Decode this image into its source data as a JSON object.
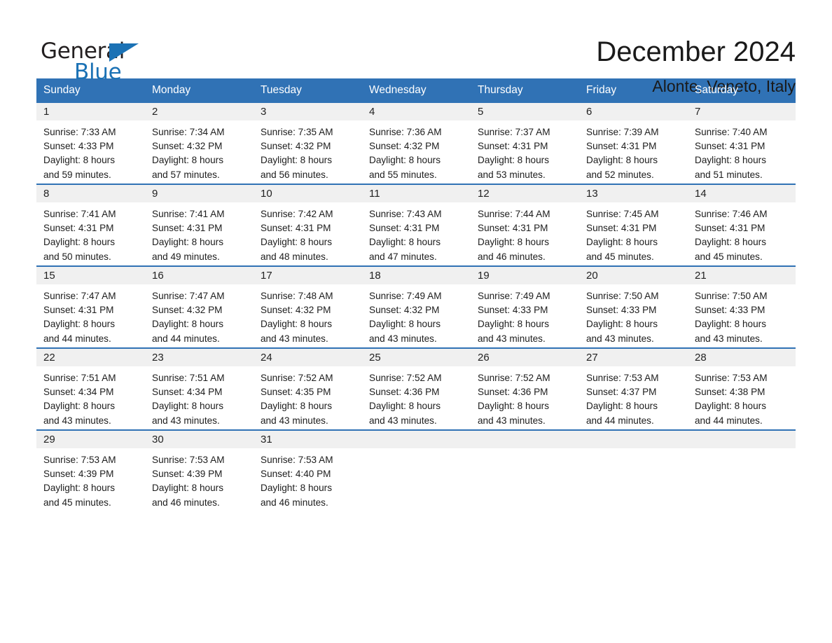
{
  "brand": {
    "logo_text_top": "General",
    "logo_text_bottom": "Blue",
    "logo_blue": "#1b72b5",
    "logo_black": "#231f20"
  },
  "header": {
    "title": "December 2024",
    "subtitle": "Alonte, Veneto, Italy"
  },
  "theme": {
    "header_blue": "#3072b5",
    "daynum_band": "#f0f0f0",
    "cell_bg": "#ffffff",
    "text": "#1a1a1a"
  },
  "calendar": {
    "weekday_headers": [
      "Sunday",
      "Monday",
      "Tuesday",
      "Wednesday",
      "Thursday",
      "Friday",
      "Saturday"
    ],
    "weeks": [
      [
        {
          "day": "1",
          "sunrise": "Sunrise: 7:33 AM",
          "sunset": "Sunset: 4:33 PM",
          "daylight1": "Daylight: 8 hours",
          "daylight2": "and 59 minutes."
        },
        {
          "day": "2",
          "sunrise": "Sunrise: 7:34 AM",
          "sunset": "Sunset: 4:32 PM",
          "daylight1": "Daylight: 8 hours",
          "daylight2": "and 57 minutes."
        },
        {
          "day": "3",
          "sunrise": "Sunrise: 7:35 AM",
          "sunset": "Sunset: 4:32 PM",
          "daylight1": "Daylight: 8 hours",
          "daylight2": "and 56 minutes."
        },
        {
          "day": "4",
          "sunrise": "Sunrise: 7:36 AM",
          "sunset": "Sunset: 4:32 PM",
          "daylight1": "Daylight: 8 hours",
          "daylight2": "and 55 minutes."
        },
        {
          "day": "5",
          "sunrise": "Sunrise: 7:37 AM",
          "sunset": "Sunset: 4:31 PM",
          "daylight1": "Daylight: 8 hours",
          "daylight2": "and 53 minutes."
        },
        {
          "day": "6",
          "sunrise": "Sunrise: 7:39 AM",
          "sunset": "Sunset: 4:31 PM",
          "daylight1": "Daylight: 8 hours",
          "daylight2": "and 52 minutes."
        },
        {
          "day": "7",
          "sunrise": "Sunrise: 7:40 AM",
          "sunset": "Sunset: 4:31 PM",
          "daylight1": "Daylight: 8 hours",
          "daylight2": "and 51 minutes."
        }
      ],
      [
        {
          "day": "8",
          "sunrise": "Sunrise: 7:41 AM",
          "sunset": "Sunset: 4:31 PM",
          "daylight1": "Daylight: 8 hours",
          "daylight2": "and 50 minutes."
        },
        {
          "day": "9",
          "sunrise": "Sunrise: 7:41 AM",
          "sunset": "Sunset: 4:31 PM",
          "daylight1": "Daylight: 8 hours",
          "daylight2": "and 49 minutes."
        },
        {
          "day": "10",
          "sunrise": "Sunrise: 7:42 AM",
          "sunset": "Sunset: 4:31 PM",
          "daylight1": "Daylight: 8 hours",
          "daylight2": "and 48 minutes."
        },
        {
          "day": "11",
          "sunrise": "Sunrise: 7:43 AM",
          "sunset": "Sunset: 4:31 PM",
          "daylight1": "Daylight: 8 hours",
          "daylight2": "and 47 minutes."
        },
        {
          "day": "12",
          "sunrise": "Sunrise: 7:44 AM",
          "sunset": "Sunset: 4:31 PM",
          "daylight1": "Daylight: 8 hours",
          "daylight2": "and 46 minutes."
        },
        {
          "day": "13",
          "sunrise": "Sunrise: 7:45 AM",
          "sunset": "Sunset: 4:31 PM",
          "daylight1": "Daylight: 8 hours",
          "daylight2": "and 45 minutes."
        },
        {
          "day": "14",
          "sunrise": "Sunrise: 7:46 AM",
          "sunset": "Sunset: 4:31 PM",
          "daylight1": "Daylight: 8 hours",
          "daylight2": "and 45 minutes."
        }
      ],
      [
        {
          "day": "15",
          "sunrise": "Sunrise: 7:47 AM",
          "sunset": "Sunset: 4:31 PM",
          "daylight1": "Daylight: 8 hours",
          "daylight2": "and 44 minutes."
        },
        {
          "day": "16",
          "sunrise": "Sunrise: 7:47 AM",
          "sunset": "Sunset: 4:32 PM",
          "daylight1": "Daylight: 8 hours",
          "daylight2": "and 44 minutes."
        },
        {
          "day": "17",
          "sunrise": "Sunrise: 7:48 AM",
          "sunset": "Sunset: 4:32 PM",
          "daylight1": "Daylight: 8 hours",
          "daylight2": "and 43 minutes."
        },
        {
          "day": "18",
          "sunrise": "Sunrise: 7:49 AM",
          "sunset": "Sunset: 4:32 PM",
          "daylight1": "Daylight: 8 hours",
          "daylight2": "and 43 minutes."
        },
        {
          "day": "19",
          "sunrise": "Sunrise: 7:49 AM",
          "sunset": "Sunset: 4:33 PM",
          "daylight1": "Daylight: 8 hours",
          "daylight2": "and 43 minutes."
        },
        {
          "day": "20",
          "sunrise": "Sunrise: 7:50 AM",
          "sunset": "Sunset: 4:33 PM",
          "daylight1": "Daylight: 8 hours",
          "daylight2": "and 43 minutes."
        },
        {
          "day": "21",
          "sunrise": "Sunrise: 7:50 AM",
          "sunset": "Sunset: 4:33 PM",
          "daylight1": "Daylight: 8 hours",
          "daylight2": "and 43 minutes."
        }
      ],
      [
        {
          "day": "22",
          "sunrise": "Sunrise: 7:51 AM",
          "sunset": "Sunset: 4:34 PM",
          "daylight1": "Daylight: 8 hours",
          "daylight2": "and 43 minutes."
        },
        {
          "day": "23",
          "sunrise": "Sunrise: 7:51 AM",
          "sunset": "Sunset: 4:34 PM",
          "daylight1": "Daylight: 8 hours",
          "daylight2": "and 43 minutes."
        },
        {
          "day": "24",
          "sunrise": "Sunrise: 7:52 AM",
          "sunset": "Sunset: 4:35 PM",
          "daylight1": "Daylight: 8 hours",
          "daylight2": "and 43 minutes."
        },
        {
          "day": "25",
          "sunrise": "Sunrise: 7:52 AM",
          "sunset": "Sunset: 4:36 PM",
          "daylight1": "Daylight: 8 hours",
          "daylight2": "and 43 minutes."
        },
        {
          "day": "26",
          "sunrise": "Sunrise: 7:52 AM",
          "sunset": "Sunset: 4:36 PM",
          "daylight1": "Daylight: 8 hours",
          "daylight2": "and 43 minutes."
        },
        {
          "day": "27",
          "sunrise": "Sunrise: 7:53 AM",
          "sunset": "Sunset: 4:37 PM",
          "daylight1": "Daylight: 8 hours",
          "daylight2": "and 44 minutes."
        },
        {
          "day": "28",
          "sunrise": "Sunrise: 7:53 AM",
          "sunset": "Sunset: 4:38 PM",
          "daylight1": "Daylight: 8 hours",
          "daylight2": "and 44 minutes."
        }
      ],
      [
        {
          "day": "29",
          "sunrise": "Sunrise: 7:53 AM",
          "sunset": "Sunset: 4:39 PM",
          "daylight1": "Daylight: 8 hours",
          "daylight2": "and 45 minutes."
        },
        {
          "day": "30",
          "sunrise": "Sunrise: 7:53 AM",
          "sunset": "Sunset: 4:39 PM",
          "daylight1": "Daylight: 8 hours",
          "daylight2": "and 46 minutes."
        },
        {
          "day": "31",
          "sunrise": "Sunrise: 7:53 AM",
          "sunset": "Sunset: 4:40 PM",
          "daylight1": "Daylight: 8 hours",
          "daylight2": "and 46 minutes."
        },
        {
          "day": "",
          "sunrise": "",
          "sunset": "",
          "daylight1": "",
          "daylight2": ""
        },
        {
          "day": "",
          "sunrise": "",
          "sunset": "",
          "daylight1": "",
          "daylight2": ""
        },
        {
          "day": "",
          "sunrise": "",
          "sunset": "",
          "daylight1": "",
          "daylight2": ""
        },
        {
          "day": "",
          "sunrise": "",
          "sunset": "",
          "daylight1": "",
          "daylight2": ""
        }
      ]
    ]
  }
}
